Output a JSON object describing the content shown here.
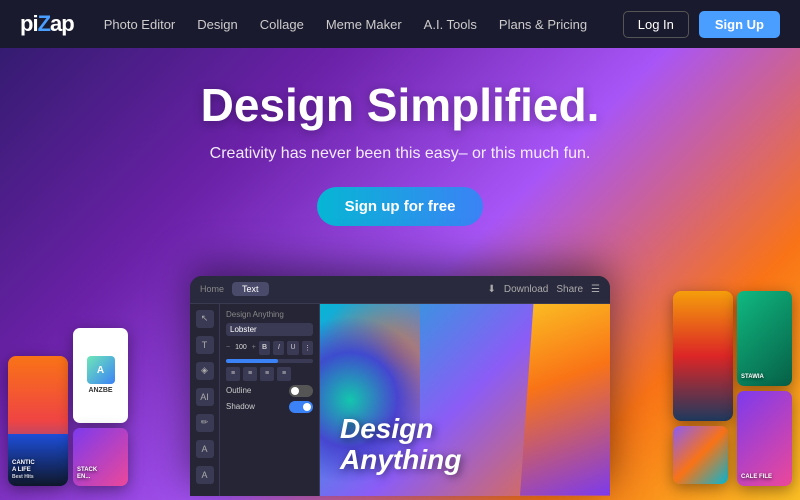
{
  "nav": {
    "logo": "piZap",
    "logo_highlight": "Z",
    "links": [
      {
        "label": "Photo Editor",
        "id": "photo-editor"
      },
      {
        "label": "Design",
        "id": "design"
      },
      {
        "label": "Collage",
        "id": "collage"
      },
      {
        "label": "Meme Maker",
        "id": "meme-maker"
      },
      {
        "label": "A.I. Tools",
        "id": "ai-tools"
      },
      {
        "label": "Plans & Pricing",
        "id": "plans-pricing"
      }
    ],
    "login_label": "Log In",
    "signup_label": "Sign Up"
  },
  "hero": {
    "title": "Design Simplified.",
    "subtitle": "Creativity has never been this easy– or this much fun.",
    "cta_label": "Sign up for free"
  },
  "app_mockup": {
    "tabs": [
      "Home",
      "Text"
    ],
    "download_btn": "Download",
    "share_btn": "Share",
    "design_anything_label": "Design Anything",
    "font_label": "Lobster",
    "outline_label": "Outline",
    "shadow_label": "Shadow",
    "canvas_text_line1": "Design",
    "canvas_text_line2": "Anything"
  },
  "cards": {
    "left": [
      {
        "label": "CANTIC A LIFE",
        "sub": "Best Hits"
      },
      {
        "label": ""
      },
      {
        "label": "STACK\nEN..."
      },
      {
        "label": ""
      }
    ],
    "right": [
      {
        "label": ""
      },
      {
        "label": "STAWIA"
      },
      {
        "label": "CALE FILE"
      },
      {
        "label": ""
      }
    ]
  }
}
